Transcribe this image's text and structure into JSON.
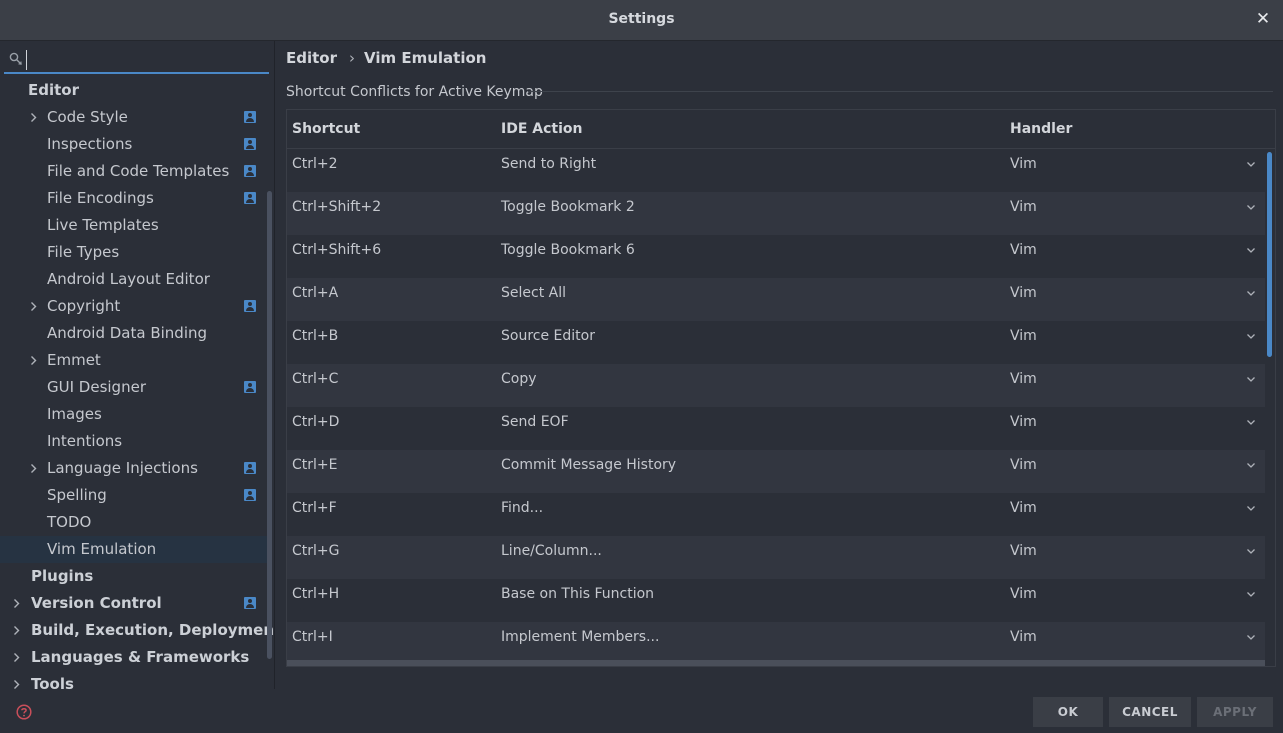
{
  "window": {
    "title": "Settings",
    "close_glyph": "✕"
  },
  "search": {
    "value": "",
    "placeholder": ""
  },
  "sidebar": {
    "items": [
      {
        "label": "Editor",
        "level": 0,
        "bold": true,
        "expandable": false,
        "project": false
      },
      {
        "label": "Code Style",
        "level": 1,
        "bold": false,
        "expandable": true,
        "project": true
      },
      {
        "label": "Inspections",
        "level": 1,
        "bold": false,
        "expandable": false,
        "project": true
      },
      {
        "label": "File and Code Templates",
        "level": 1,
        "bold": false,
        "expandable": false,
        "project": true
      },
      {
        "label": "File Encodings",
        "level": 1,
        "bold": false,
        "expandable": false,
        "project": true
      },
      {
        "label": "Live Templates",
        "level": 1,
        "bold": false,
        "expandable": false,
        "project": false
      },
      {
        "label": "File Types",
        "level": 1,
        "bold": false,
        "expandable": false,
        "project": false
      },
      {
        "label": "Android Layout Editor",
        "level": 1,
        "bold": false,
        "expandable": false,
        "project": false
      },
      {
        "label": "Copyright",
        "level": 1,
        "bold": false,
        "expandable": true,
        "project": true
      },
      {
        "label": "Android Data Binding",
        "level": 1,
        "bold": false,
        "expandable": false,
        "project": false
      },
      {
        "label": "Emmet",
        "level": 1,
        "bold": false,
        "expandable": true,
        "project": false
      },
      {
        "label": "GUI Designer",
        "level": 1,
        "bold": false,
        "expandable": false,
        "project": true
      },
      {
        "label": "Images",
        "level": 1,
        "bold": false,
        "expandable": false,
        "project": false
      },
      {
        "label": "Intentions",
        "level": 1,
        "bold": false,
        "expandable": false,
        "project": false
      },
      {
        "label": "Language Injections",
        "level": 1,
        "bold": false,
        "expandable": true,
        "project": true
      },
      {
        "label": "Spelling",
        "level": 1,
        "bold": false,
        "expandable": false,
        "project": true
      },
      {
        "label": "TODO",
        "level": 1,
        "bold": false,
        "expandable": false,
        "project": false
      },
      {
        "label": "Vim Emulation",
        "level": 1,
        "bold": false,
        "expandable": false,
        "project": false,
        "selected": true
      },
      {
        "label": "Plugins",
        "level": 0,
        "bold": true,
        "expandable": false,
        "project": false
      },
      {
        "label": "Version Control",
        "level": 0,
        "bold": true,
        "expandable": true,
        "project": true
      },
      {
        "label": "Build, Execution, Deployment",
        "level": 0,
        "bold": true,
        "expandable": true,
        "project": false
      },
      {
        "label": "Languages & Frameworks",
        "level": 0,
        "bold": true,
        "expandable": true,
        "project": false
      },
      {
        "label": "Tools",
        "level": 0,
        "bold": true,
        "expandable": true,
        "project": false
      }
    ]
  },
  "breadcrumb": {
    "parent": "Editor",
    "separator": "›",
    "current": "Vim Emulation"
  },
  "section": {
    "title": "Shortcut Conflicts for Active Keymap"
  },
  "table": {
    "headers": {
      "shortcut": "Shortcut",
      "action": "IDE Action",
      "handler": "Handler"
    },
    "rows": [
      {
        "shortcut": "Ctrl+2",
        "action": "Send to Right",
        "handler": "Vim"
      },
      {
        "shortcut": "Ctrl+Shift+2",
        "action": "Toggle Bookmark 2",
        "handler": "Vim"
      },
      {
        "shortcut": "Ctrl+Shift+6",
        "action": "Toggle Bookmark 6",
        "handler": "Vim"
      },
      {
        "shortcut": "Ctrl+A",
        "action": "Select All",
        "handler": "Vim"
      },
      {
        "shortcut": "Ctrl+B",
        "action": "Source Editor",
        "handler": "Vim"
      },
      {
        "shortcut": "Ctrl+C",
        "action": "Copy",
        "handler": "Vim"
      },
      {
        "shortcut": "Ctrl+D",
        "action": "Send EOF",
        "handler": "Vim"
      },
      {
        "shortcut": "Ctrl+E",
        "action": "Commit Message History",
        "handler": "Vim"
      },
      {
        "shortcut": "Ctrl+F",
        "action": "Find...",
        "handler": "Vim"
      },
      {
        "shortcut": "Ctrl+G",
        "action": "Line/Column...",
        "handler": "Vim"
      },
      {
        "shortcut": "Ctrl+H",
        "action": "Base on This Function",
        "handler": "Vim"
      },
      {
        "shortcut": "Ctrl+I",
        "action": "Implement Members...",
        "handler": "Vim"
      }
    ]
  },
  "footer": {
    "ok_label": "OK",
    "cancel_label": "CANCEL",
    "apply_label": "APPLY"
  },
  "colors": {
    "accent": "#4a88c7",
    "selected_row": "#263342",
    "help": "#c94f5a"
  },
  "icons": {
    "search": "search-icon",
    "help": "help-icon",
    "project": "project-level-icon",
    "dropdown": "chevron-down-icon",
    "expand": "chevron-right-icon",
    "close": "close-icon"
  }
}
